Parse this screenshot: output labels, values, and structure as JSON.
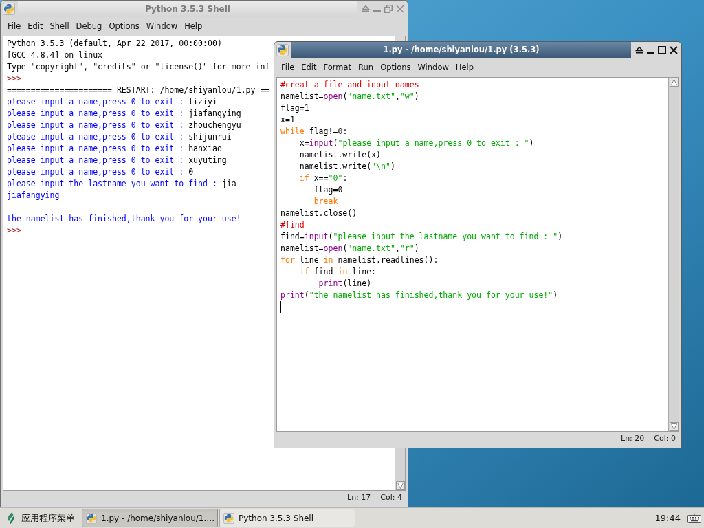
{
  "shell_window": {
    "title": "Python 3.5.3 Shell",
    "active": false,
    "maximized": true,
    "menu": [
      "File",
      "Edit",
      "Shell",
      "Debug",
      "Options",
      "Window",
      "Help"
    ],
    "lines": [
      {
        "segments": [
          {
            "kind": "plain",
            "text": "Python 3.5.3 (default, Apr 22 2017, 00:00:00)"
          }
        ]
      },
      {
        "segments": [
          {
            "kind": "plain",
            "text": "[GCC 4.8.4] on linux"
          }
        ]
      },
      {
        "segments": [
          {
            "kind": "plain",
            "text": "Type \"copyright\", \"credits\" or \"license()\" for more inf"
          }
        ]
      },
      {
        "segments": [
          {
            "kind": "prompt",
            "text": ">>>"
          }
        ]
      },
      {
        "segments": [
          {
            "kind": "plain",
            "text": "====================== RESTART: /home/shiyanlou/1.py =="
          }
        ]
      },
      {
        "segments": [
          {
            "kind": "stdout",
            "text": "please input a name,press 0 to exit : "
          },
          {
            "kind": "stdin",
            "text": "liziyi"
          }
        ]
      },
      {
        "segments": [
          {
            "kind": "stdout",
            "text": "please input a name,press 0 to exit : "
          },
          {
            "kind": "stdin",
            "text": "jiafangying"
          }
        ]
      },
      {
        "segments": [
          {
            "kind": "stdout",
            "text": "please input a name,press 0 to exit : "
          },
          {
            "kind": "stdin",
            "text": "zhouchengyu"
          }
        ]
      },
      {
        "segments": [
          {
            "kind": "stdout",
            "text": "please input a name,press 0 to exit : "
          },
          {
            "kind": "stdin",
            "text": "shijunrui"
          }
        ]
      },
      {
        "segments": [
          {
            "kind": "stdout",
            "text": "please input a name,press 0 to exit : "
          },
          {
            "kind": "stdin",
            "text": "hanxiao"
          }
        ]
      },
      {
        "segments": [
          {
            "kind": "stdout",
            "text": "please input a name,press 0 to exit : "
          },
          {
            "kind": "stdin",
            "text": "xuyuting"
          }
        ]
      },
      {
        "segments": [
          {
            "kind": "stdout",
            "text": "please input a name,press 0 to exit : "
          },
          {
            "kind": "stdin",
            "text": "0"
          }
        ]
      },
      {
        "segments": [
          {
            "kind": "stdout",
            "text": "please input the lastname you want to find : "
          },
          {
            "kind": "stdin",
            "text": "jia"
          }
        ]
      },
      {
        "segments": [
          {
            "kind": "stdout",
            "text": "jiafangying"
          }
        ],
        "blank_after": true
      },
      {
        "segments": [
          {
            "kind": "stdout",
            "text": "the namelist has finished,thank you for your use!"
          }
        ]
      },
      {
        "segments": [
          {
            "kind": "prompt",
            "text": ">>>"
          }
        ]
      }
    ],
    "status": [
      "Ln: 17",
      "Col: 4"
    ]
  },
  "editor_window": {
    "title": "1.py - /home/shiyanlou/1.py (3.5.3)",
    "active": true,
    "maximized": false,
    "menu": [
      "File",
      "Edit",
      "Format",
      "Run",
      "Options",
      "Window",
      "Help"
    ],
    "code": [
      {
        "segments": [
          {
            "kind": "comment",
            "text": "#creat a file and input names"
          }
        ]
      },
      {
        "segments": [
          {
            "kind": "plain",
            "text": "namelist="
          },
          {
            "kind": "builtin",
            "text": "open"
          },
          {
            "kind": "plain",
            "text": "("
          },
          {
            "kind": "string",
            "text": "\"name.txt\""
          },
          {
            "kind": "plain",
            "text": ","
          },
          {
            "kind": "string",
            "text": "\"w\""
          },
          {
            "kind": "plain",
            "text": ")"
          }
        ]
      },
      {
        "segments": [
          {
            "kind": "plain",
            "text": "flag=1"
          }
        ]
      },
      {
        "segments": [
          {
            "kind": "plain",
            "text": "x=1"
          }
        ]
      },
      {
        "segments": [
          {
            "kind": "keyword",
            "text": "while"
          },
          {
            "kind": "plain",
            "text": " flag!=0:"
          }
        ]
      },
      {
        "segments": [
          {
            "kind": "plain",
            "text": "    x="
          },
          {
            "kind": "builtin",
            "text": "input"
          },
          {
            "kind": "plain",
            "text": "("
          },
          {
            "kind": "string",
            "text": "\"please input a name,press 0 to exit : \""
          },
          {
            "kind": "plain",
            "text": ")"
          }
        ]
      },
      {
        "segments": [
          {
            "kind": "plain",
            "text": "    namelist.write(x)"
          }
        ]
      },
      {
        "segments": [
          {
            "kind": "plain",
            "text": "    namelist.write("
          },
          {
            "kind": "string",
            "text": "\"\\n\""
          },
          {
            "kind": "plain",
            "text": ")"
          }
        ]
      },
      {
        "segments": [
          {
            "kind": "keyword",
            "text": "    if"
          },
          {
            "kind": "plain",
            "text": " x=="
          },
          {
            "kind": "string",
            "text": "\"0\""
          },
          {
            "kind": "plain",
            "text": ":"
          }
        ]
      },
      {
        "segments": [
          {
            "kind": "plain",
            "text": "       flag=0"
          }
        ]
      },
      {
        "segments": [
          {
            "kind": "keyword",
            "text": "       break"
          }
        ]
      },
      {
        "segments": [
          {
            "kind": "plain",
            "text": "namelist.close()"
          }
        ]
      },
      {
        "segments": [
          {
            "kind": "comment",
            "text": "#find"
          }
        ]
      },
      {
        "segments": [
          {
            "kind": "plain",
            "text": "find="
          },
          {
            "kind": "builtin",
            "text": "input"
          },
          {
            "kind": "plain",
            "text": "("
          },
          {
            "kind": "string",
            "text": "\"please input the lastname you want to find : \""
          },
          {
            "kind": "plain",
            "text": ")"
          }
        ]
      },
      {
        "segments": [
          {
            "kind": "plain",
            "text": "namelist="
          },
          {
            "kind": "builtin",
            "text": "open"
          },
          {
            "kind": "plain",
            "text": "("
          },
          {
            "kind": "string",
            "text": "\"name.txt\""
          },
          {
            "kind": "plain",
            "text": ","
          },
          {
            "kind": "string",
            "text": "\"r\""
          },
          {
            "kind": "plain",
            "text": ")"
          }
        ]
      },
      {
        "segments": [
          {
            "kind": "keyword",
            "text": "for"
          },
          {
            "kind": "plain",
            "text": " line "
          },
          {
            "kind": "keyword",
            "text": "in"
          },
          {
            "kind": "plain",
            "text": " namelist.readlines():"
          }
        ]
      },
      {
        "segments": [
          {
            "kind": "keyword",
            "text": "    if"
          },
          {
            "kind": "plain",
            "text": " find "
          },
          {
            "kind": "keyword",
            "text": "in"
          },
          {
            "kind": "plain",
            "text": " line:"
          }
        ]
      },
      {
        "segments": [
          {
            "kind": "builtin",
            "text": "        print"
          },
          {
            "kind": "plain",
            "text": "(line)"
          }
        ]
      },
      {
        "segments": [
          {
            "kind": "builtin",
            "text": "print"
          },
          {
            "kind": "plain",
            "text": "("
          },
          {
            "kind": "string",
            "text": "\"the namelist has finished,thank you for your use!\""
          },
          {
            "kind": "plain",
            "text": ")"
          }
        ]
      }
    ],
    "text_cursor": true,
    "status": [
      "Ln: 20",
      "Col: 0"
    ]
  },
  "taskbar": {
    "start_label": "应用程序菜单",
    "tasks": [
      {
        "label": "1.py - /home/shiyanlou/1.…",
        "selected": true
      },
      {
        "label": "Python 3.5.3 Shell",
        "selected": false
      }
    ],
    "clock": "19:44"
  }
}
